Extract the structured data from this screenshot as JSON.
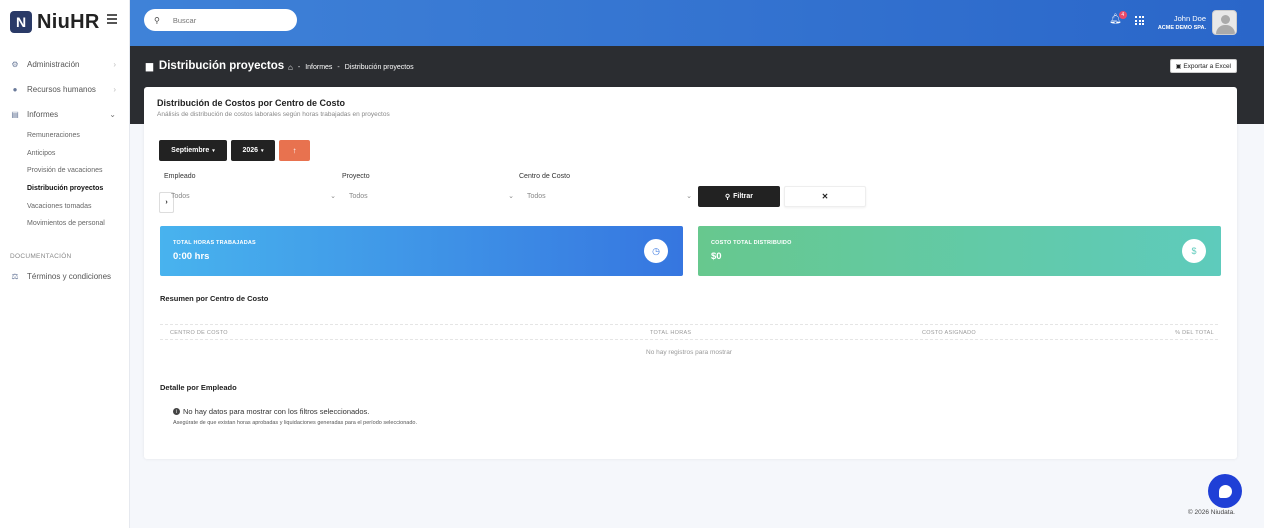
{
  "brand": {
    "name": "NiuHR"
  },
  "search": {
    "placeholder": "Buscar"
  },
  "notifications": {
    "count": "4"
  },
  "user": {
    "name": "John Doe",
    "company": "ACME DEMO SPA."
  },
  "sidebar": {
    "items": [
      {
        "label": "Administración",
        "icon": "gears-icon"
      },
      {
        "label": "Recursos humanos",
        "icon": "user-icon"
      },
      {
        "label": "Informes",
        "icon": "document-icon"
      }
    ],
    "informes_sub": [
      "Remuneraciones",
      "Anticipos",
      "Provisión de vacaciones",
      "Distribución proyectos",
      "Vacaciones tomadas",
      "Movimientos de personal"
    ],
    "active_sub": "Distribución proyectos",
    "section_label": "DOCUMENTACIÓN",
    "terms": "Términos y condiciones"
  },
  "header": {
    "title": "Distribución proyectos",
    "breadcrumb": [
      "Informes",
      "Distribución proyectos"
    ],
    "breadcrumb_sep": "-",
    "export_label": "Exportar a Excel"
  },
  "card": {
    "title": "Distribución de Costos por Centro de Costo",
    "subtitle": "Análisis de distribución de costos laborales según horas trabajadas en proyectos"
  },
  "period": {
    "month": "Septiembre",
    "year": "2026",
    "prev": "‹",
    "next": "›"
  },
  "filters": {
    "empleado": {
      "label": "Empleado",
      "value": "Todos"
    },
    "proyecto": {
      "label": "Proyecto",
      "value": "Todos"
    },
    "centro": {
      "label": "Centro de Costo",
      "value": "Todos"
    },
    "filtrar_label": "Filtrar",
    "clear_label": "✕"
  },
  "stats": {
    "hours": {
      "label": "TOTAL HORAS TRABAJADAS",
      "value": "0:00 hrs",
      "color": "#3676e0"
    },
    "cost": {
      "label": "COSTO TOTAL DISTRIBUIDO",
      "value": "$0",
      "color": "#5ecbbc"
    }
  },
  "summary": {
    "title": "Resumen por Centro de Costo",
    "columns": [
      "CENTRO DE COSTO",
      "TOTAL HORAS",
      "COSTO ASIGNADO",
      "% DEL TOTAL"
    ],
    "empty": "No hay registros para mostrar"
  },
  "detail": {
    "title": "Detalle por Empleado",
    "message": "No hay datos para mostrar con los filtros seleccionados.",
    "hint": "Asegúrate de que existan horas aprobadas y liquidaciones generadas para el período seleccionado."
  },
  "footer": {
    "text": "© 2026 Niudata."
  }
}
